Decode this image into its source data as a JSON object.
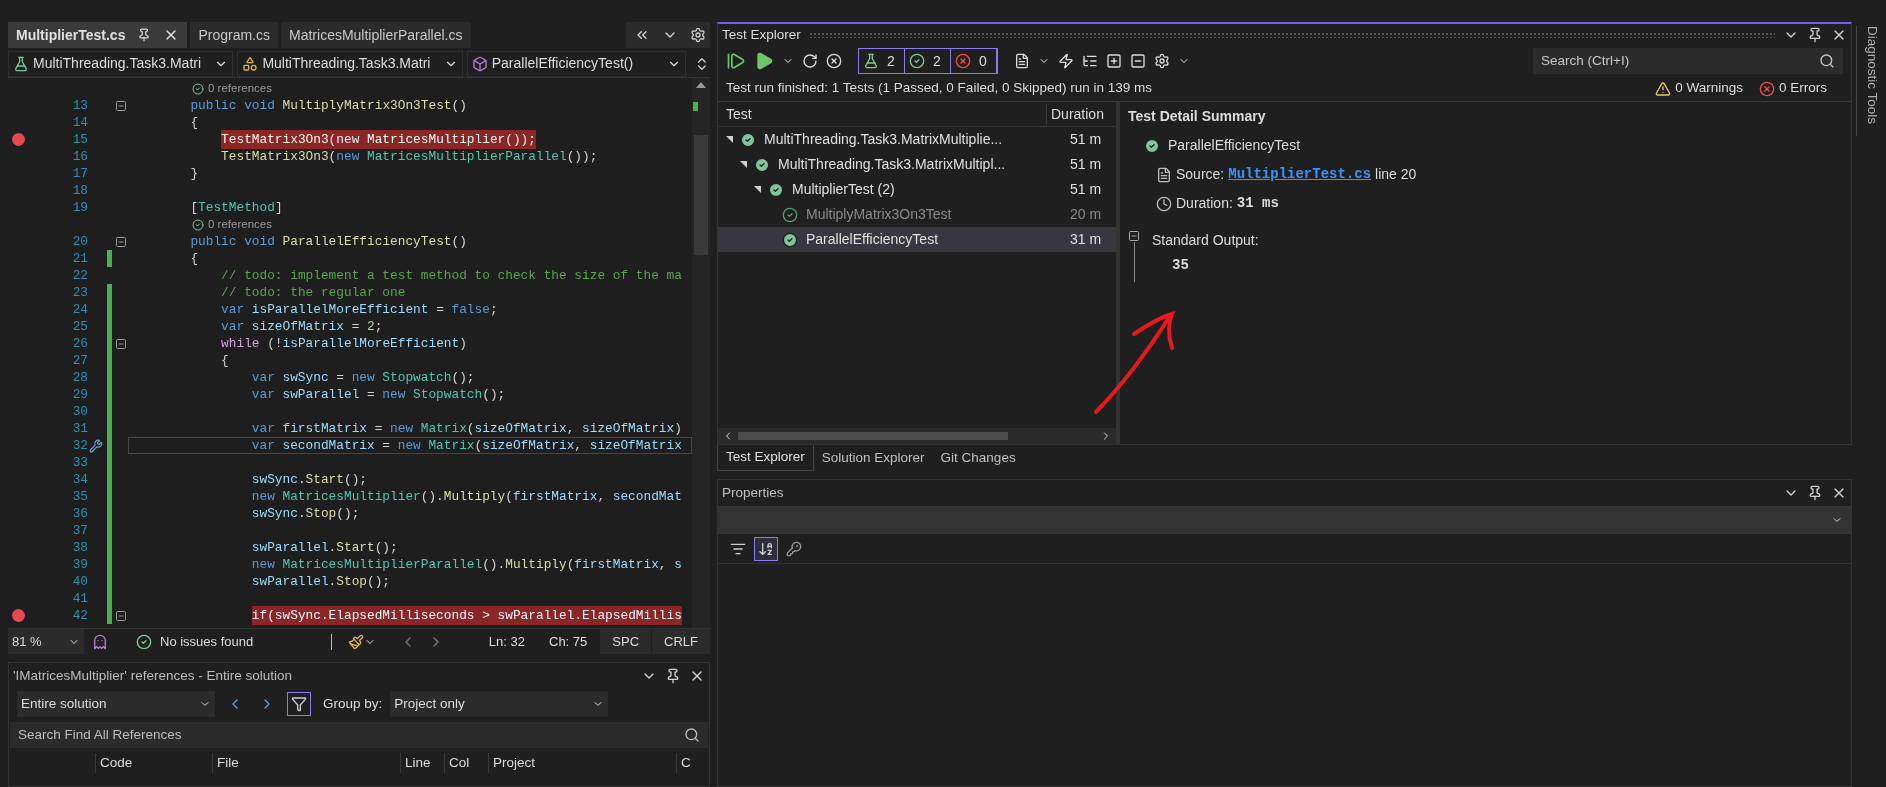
{
  "editor": {
    "tabs": [
      {
        "label": "MultiplierTest.cs",
        "selected": true
      },
      {
        "label": "Program.cs",
        "selected": false
      },
      {
        "label": "MatricesMultiplierParallel.cs",
        "selected": false
      }
    ],
    "nav": [
      {
        "kind": "project",
        "label": "MultiThreading.Task3.Matri"
      },
      {
        "kind": "class",
        "label": "MultiThreading.Task3.Matri"
      },
      {
        "kind": "member",
        "label": "ParallelEfficiencyTest()"
      }
    ],
    "lines": [
      {
        "kind": "lens",
        "text": "0 references"
      },
      {
        "kind": "code",
        "number": "13",
        "breakpoint": false,
        "changed": false,
        "current": false,
        "quick_action": false,
        "fold": true,
        "tokens": [
          {
            "text": "public void ",
            "kind": "keyword"
          },
          {
            "text": "MultiplyMatrix3On3Test",
            "kind": "method"
          },
          {
            "text": "()",
            "kind": "plain"
          }
        ]
      },
      {
        "kind": "code",
        "number": "14",
        "breakpoint": false,
        "changed": false,
        "current": false,
        "quick_action": false,
        "fold": false,
        "tokens": [
          {
            "text": "{",
            "kind": "plain"
          }
        ],
        "children": [
          {
            "kind": "code",
            "number": "15",
            "breakpoint": true,
            "changed": false,
            "current": false,
            "quick_action": false,
            "fold": false,
            "tokens": [
              {
                "text": "TestMatrix3On3",
                "kind": "method"
              },
              {
                "text": "(",
                "kind": "plain"
              },
              {
                "text": "new ",
                "kind": "keyword"
              },
              {
                "text": "MatricesMultiplier",
                "kind": "type"
              },
              {
                "text": "());",
                "kind": "plain"
              }
            ]
          },
          {
            "kind": "code",
            "number": "16",
            "breakpoint": false,
            "changed": false,
            "current": false,
            "quick_action": false,
            "fold": false,
            "tokens": [
              {
                "text": "TestMatrix3On3",
                "kind": "method"
              },
              {
                "text": "(",
                "kind": "plain"
              },
              {
                "text": "new ",
                "kind": "keyword"
              },
              {
                "text": "MatricesMultiplierParallel",
                "kind": "type"
              },
              {
                "text": "());",
                "kind": "plain"
              }
            ]
          }
        ]
      },
      {
        "kind": "code",
        "number": "17",
        "breakpoint": false,
        "changed": false,
        "current": false,
        "quick_action": false,
        "fold": false,
        "tokens": [
          {
            "text": "}",
            "kind": "plain"
          }
        ]
      },
      {
        "kind": "code",
        "number": "18",
        "breakpoint": false,
        "changed": false,
        "current": false,
        "quick_action": false,
        "fold": false
      },
      {
        "kind": "code",
        "number": "19",
        "breakpoint": false,
        "changed": false,
        "current": false,
        "quick_action": false,
        "fold": false,
        "tokens": [
          {
            "text": "[",
            "kind": "plain"
          },
          {
            "text": "TestMethod",
            "kind": "type"
          },
          {
            "text": "]",
            "kind": "plain"
          }
        ]
      },
      {
        "kind": "lens",
        "text": "0 references"
      },
      {
        "kind": "code",
        "number": "20",
        "breakpoint": false,
        "changed": false,
        "current": false,
        "quick_action": false,
        "fold": true,
        "tokens": [
          {
            "text": "public void ",
            "kind": "keyword"
          },
          {
            "text": "ParallelEfficiencyTest",
            "kind": "method"
          },
          {
            "text": "()",
            "kind": "plain"
          }
        ]
      },
      {
        "kind": "code",
        "number": "21",
        "breakpoint": false,
        "changed": true,
        "current": false,
        "quick_action": false,
        "fold": false,
        "tokens": [
          {
            "text": "{",
            "kind": "plain"
          }
        ],
        "children": [
          {
            "kind": "code",
            "number": "22",
            "breakpoint": false,
            "changed": false,
            "current": false,
            "quick_action": false,
            "fold": false,
            "tokens": [
              {
                "text": "// todo: implement a test method to check the size of the ma",
                "kind": "comment"
              }
            ]
          },
          {
            "kind": "code",
            "number": "23",
            "breakpoint": false,
            "changed": true,
            "current": false,
            "quick_action": false,
            "fold": false,
            "tokens": [
              {
                "text": "// todo: the regular one",
                "kind": "comment"
              }
            ]
          },
          {
            "kind": "code",
            "number": "24",
            "breakpoint": false,
            "changed": true,
            "current": false,
            "quick_action": false,
            "fold": false,
            "tokens": [
              {
                "text": "var ",
                "kind": "keyword"
              },
              {
                "text": "isParallelMoreEfficient",
                "kind": "variable"
              },
              {
                "text": " = ",
                "kind": "plain"
              },
              {
                "text": "false",
                "kind": "keyword"
              },
              {
                "text": ";",
                "kind": "plain"
              }
            ]
          },
          {
            "kind": "code",
            "number": "25",
            "breakpoint": false,
            "changed": true,
            "current": false,
            "quick_action": false,
            "fold": false,
            "tokens": [
              {
                "text": "var ",
                "kind": "keyword"
              },
              {
                "text": "sizeOfMatrix",
                "kind": "variable"
              },
              {
                "text": " = ",
                "kind": "plain"
              },
              {
                "text": "2",
                "kind": "number"
              },
              {
                "text": ";",
                "kind": "plain"
              }
            ]
          },
          {
            "kind": "code",
            "number": "26",
            "breakpoint": false,
            "changed": true,
            "current": false,
            "quick_action": false,
            "fold": true,
            "tokens": [
              {
                "text": "while",
                "kind": "control"
              },
              {
                "text": " (!",
                "kind": "plain"
              },
              {
                "text": "isParallelMoreEfficient",
                "kind": "variable"
              },
              {
                "text": ")",
                "kind": "plain"
              }
            ]
          },
          {
            "kind": "code",
            "number": "27",
            "breakpoint": false,
            "changed": true,
            "current": false,
            "quick_action": false,
            "fold": false,
            "tokens": [
              {
                "text": "{",
                "kind": "plain"
              }
            ],
            "children": [
              {
                "kind": "code",
                "number": "28",
                "breakpoint": false,
                "changed": true,
                "current": false,
                "quick_action": false,
                "fold": false,
                "tokens": [
                  {
                    "text": "var ",
                    "kind": "keyword"
                  },
                  {
                    "text": "swSync",
                    "kind": "variable"
                  },
                  {
                    "text": " = ",
                    "kind": "plain"
                  },
                  {
                    "text": "new ",
                    "kind": "keyword"
                  },
                  {
                    "text": "Stopwatch",
                    "kind": "type"
                  },
                  {
                    "text": "();",
                    "kind": "plain"
                  }
                ]
              },
              {
                "kind": "code",
                "number": "29",
                "breakpoint": false,
                "changed": true,
                "current": false,
                "quick_action": false,
                "fold": false,
                "tokens": [
                  {
                    "text": "var ",
                    "kind": "keyword"
                  },
                  {
                    "text": "swParallel",
                    "kind": "variable"
                  },
                  {
                    "text": " = ",
                    "kind": "plain"
                  },
                  {
                    "text": "new ",
                    "kind": "keyword"
                  },
                  {
                    "text": "Stopwatch",
                    "kind": "type"
                  },
                  {
                    "text": "();",
                    "kind": "plain"
                  }
                ]
              },
              {
                "kind": "code",
                "number": "30",
                "breakpoint": false,
                "changed": true,
                "current": false,
                "quick_action": false,
                "fold": false
              },
              {
                "kind": "code",
                "number": "31",
                "breakpoint": false,
                "changed": true,
                "current": false,
                "quick_action": false,
                "fold": false,
                "tokens": [
                  {
                    "text": "var ",
                    "kind": "keyword"
                  },
                  {
                    "text": "firstMatrix",
                    "kind": "variable"
                  },
                  {
                    "text": " = ",
                    "kind": "plain"
                  },
                  {
                    "text": "new ",
                    "kind": "keyword"
                  },
                  {
                    "text": "Matrix",
                    "kind": "type"
                  },
                  {
                    "text": "(",
                    "kind": "plain"
                  },
                  {
                    "text": "sizeOfMatrix",
                    "kind": "variable"
                  },
                  {
                    "text": ", ",
                    "kind": "plain"
                  },
                  {
                    "text": "sizeOfMatrix",
                    "kind": "variable"
                  },
                  {
                    "text": ")",
                    "kind": "plain"
                  }
                ]
              },
              {
                "kind": "code",
                "number": "32",
                "breakpoint": false,
                "changed": true,
                "current": true,
                "quick_action": true,
                "fold": false,
                "tokens": [
                  {
                    "text": "var ",
                    "kind": "keyword"
                  },
                  {
                    "text": "secondMatrix",
                    "kind": "variable"
                  },
                  {
                    "text": " = ",
                    "kind": "plain"
                  },
                  {
                    "text": "new ",
                    "kind": "keyword"
                  },
                  {
                    "text": "Matrix",
                    "kind": "type"
                  },
                  {
                    "text": "(",
                    "kind": "plain"
                  },
                  {
                    "text": "sizeOfMatrix",
                    "kind": "variable"
                  },
                  {
                    "text": ", ",
                    "kind": "plain"
                  },
                  {
                    "text": "sizeOfMatrix",
                    "kind": "variable"
                  }
                ]
              },
              {
                "kind": "code",
                "number": "33",
                "breakpoint": false,
                "changed": true,
                "current": false,
                "quick_action": false,
                "fold": false
              },
              {
                "kind": "code",
                "number": "34",
                "breakpoint": false,
                "changed": true,
                "current": false,
                "quick_action": false,
                "fold": false,
                "tokens": [
                  {
                    "text": "swSync",
                    "kind": "variable"
                  },
                  {
                    "text": ".",
                    "kind": "plain"
                  },
                  {
                    "text": "Start",
                    "kind": "method"
                  },
                  {
                    "text": "();",
                    "kind": "plain"
                  }
                ]
              },
              {
                "kind": "code",
                "number": "35",
                "breakpoint": false,
                "changed": true,
                "current": false,
                "quick_action": false,
                "fold": false,
                "tokens": [
                  {
                    "text": "new ",
                    "kind": "keyword"
                  },
                  {
                    "text": "MatricesMultiplier",
                    "kind": "type"
                  },
                  {
                    "text": "().",
                    "kind": "plain"
                  },
                  {
                    "text": "Multiply",
                    "kind": "method"
                  },
                  {
                    "text": "(",
                    "kind": "plain"
                  },
                  {
                    "text": "firstMatrix",
                    "kind": "variable"
                  },
                  {
                    "text": ", ",
                    "kind": "plain"
                  },
                  {
                    "text": "secondMat",
                    "kind": "variable"
                  }
                ]
              },
              {
                "kind": "code",
                "number": "36",
                "breakpoint": false,
                "changed": true,
                "current": false,
                "quick_action": false,
                "fold": false,
                "tokens": [
                  {
                    "text": "swSync",
                    "kind": "variable"
                  },
                  {
                    "text": ".",
                    "kind": "plain"
                  },
                  {
                    "text": "Stop",
                    "kind": "method"
                  },
                  {
                    "text": "();",
                    "kind": "plain"
                  }
                ]
              },
              {
                "kind": "code",
                "number": "37",
                "breakpoint": false,
                "changed": true,
                "current": false,
                "quick_action": false,
                "fold": false
              },
              {
                "kind": "code",
                "number": "38",
                "breakpoint": false,
                "changed": true,
                "current": false,
                "quick_action": false,
                "fold": false,
                "tokens": [
                  {
                    "text": "swParallel",
                    "kind": "variable"
                  },
                  {
                    "text": ".",
                    "kind": "plain"
                  },
                  {
                    "text": "Start",
                    "kind": "method"
                  },
                  {
                    "text": "();",
                    "kind": "plain"
                  }
                ]
              },
              {
                "kind": "code",
                "number": "39",
                "breakpoint": false,
                "changed": true,
                "current": false,
                "quick_action": false,
                "fold": false,
                "tokens": [
                  {
                    "text": "new ",
                    "kind": "keyword"
                  },
                  {
                    "text": "MatricesMultiplierParallel",
                    "kind": "type"
                  },
                  {
                    "text": "().",
                    "kind": "plain"
                  },
                  {
                    "text": "Multiply",
                    "kind": "method"
                  },
                  {
                    "text": "(",
                    "kind": "plain"
                  },
                  {
                    "text": "firstMatrix",
                    "kind": "variable"
                  },
                  {
                    "text": ", ",
                    "kind": "plain"
                  },
                  {
                    "text": "s",
                    "kind": "variable"
                  }
                ]
              },
              {
                "kind": "code",
                "number": "40",
                "breakpoint": false,
                "changed": true,
                "current": false,
                "quick_action": false,
                "fold": false,
                "tokens": [
                  {
                    "text": "swParallel",
                    "kind": "variable"
                  },
                  {
                    "text": ".",
                    "kind": "plain"
                  },
                  {
                    "text": "Stop",
                    "kind": "method"
                  },
                  {
                    "text": "();",
                    "kind": "plain"
                  }
                ]
              },
              {
                "kind": "code",
                "number": "41",
                "breakpoint": false,
                "changed": true,
                "current": false,
                "quick_action": false,
                "fold": false
              },
              {
                "kind": "code",
                "number": "42",
                "breakpoint": true,
                "changed": true,
                "current": false,
                "quick_action": false,
                "fold": true,
                "tokens": [
                  {
                    "text": "if",
                    "kind": "control"
                  },
                  {
                    "text": "(",
                    "kind": "plain"
                  },
                  {
                    "text": "swSync",
                    "kind": "variable"
                  },
                  {
                    "text": ".",
                    "kind": "plain"
                  },
                  {
                    "text": "ElapsedMilliseconds",
                    "kind": "variable"
                  },
                  {
                    "text": " > ",
                    "kind": "plain"
                  },
                  {
                    "text": "swParallel",
                    "kind": "variable"
                  },
                  {
                    "text": ".",
                    "kind": "plain"
                  },
                  {
                    "text": "ElapsedMillis",
                    "kind": "variable"
                  }
                ]
              }
            ]
          }
        ]
      }
    ],
    "status": {
      "zoom": "81 %",
      "issues": "No issues found",
      "line": "Ln: 32",
      "column": "Ch: 75",
      "whitespace": "SPC",
      "line_ending": "CRLF"
    }
  },
  "references": {
    "title": "'IMatricesMultiplier' references - Entire solution",
    "scope": "Entire solution",
    "tool_buttons": [
      {
        "kind": "previous",
        "selected": false
      },
      {
        "kind": "next",
        "selected": false
      },
      {
        "kind": "filter",
        "selected": true
      }
    ],
    "group_label": "Group by:",
    "group_value": "Project only",
    "search": {
      "placeholder": "Search Find All References"
    },
    "columns": [
      "Code",
      "File",
      "Line",
      "Col",
      "Project",
      "C"
    ]
  },
  "test_explorer": {
    "title": "Test Explorer",
    "counters": [
      {
        "kind": "total",
        "count": "2"
      },
      {
        "kind": "passed",
        "count": "2"
      },
      {
        "kind": "failed",
        "count": "0"
      }
    ],
    "search": {
      "placeholder": "Search (Ctrl+I)"
    },
    "summary": "Test run finished: 1 Tests (1 Passed, 0 Failed, 0 Skipped) run in 139 ms",
    "warnings": "0 Warnings",
    "errors": "0 Errors",
    "columns": [
      "Test",
      "Duration"
    ],
    "tree": [
      {
        "name": "MultiThreading.Task3.MatrixMultiplie...",
        "duration": "51 m",
        "expanded": true,
        "selected": false,
        "dimmed": false,
        "children": [
          {
            "name": "MultiThreading.Task3.MatrixMultipl...",
            "duration": "51 m",
            "expanded": true,
            "selected": false,
            "dimmed": false,
            "children": [
              {
                "name": "MultiplierTest  (2)",
                "duration": "51 m",
                "expanded": true,
                "selected": false,
                "dimmed": false,
                "children": [
                  {
                    "name": "MultiplyMatrix3On3Test",
                    "duration": "20 m",
                    "selected": false,
                    "dimmed": true
                  },
                  {
                    "name": "ParallelEfficiencyTest",
                    "duration": "31 m",
                    "selected": true,
                    "dimmed": false
                  }
                ]
              }
            ]
          }
        ]
      }
    ],
    "detail": {
      "title": "Test Detail Summary",
      "test_name": "ParallelEfficiencyTest",
      "source_label": "Source:",
      "source_file": "MultiplierTest.cs",
      "source_line": "line 20",
      "duration_label": "Duration:",
      "duration": "31 ms",
      "output_label": "Standard Output:",
      "output": "35"
    },
    "annotations": [
      {
        "kind": "arrow"
      }
    ],
    "bottom_tabs": [
      {
        "label": "Test Explorer",
        "selected": true
      },
      {
        "label": "Solution Explorer",
        "selected": false
      },
      {
        "label": "Git Changes",
        "selected": false
      }
    ]
  },
  "properties": {
    "title": "Properties",
    "tool_buttons": [
      {
        "kind": "categorized",
        "selected": false
      },
      {
        "kind": "alphabetical",
        "selected": true
      },
      {
        "kind": "pages",
        "selected": false
      }
    ]
  },
  "side_tab": "Diagnostic Tools"
}
